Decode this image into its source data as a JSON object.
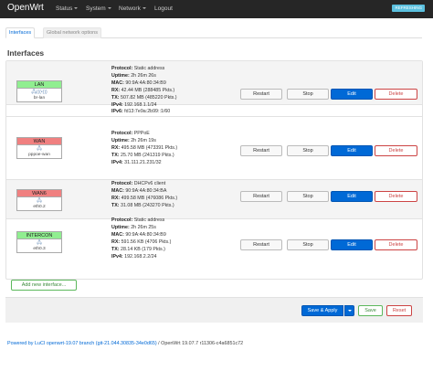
{
  "brand": "OpenWrt",
  "nav": {
    "status": "Status",
    "system": "System",
    "network": "Network",
    "logout": "Logout"
  },
  "badge": "REFRESHING",
  "tabs": [
    "Interfaces",
    "Global network options"
  ],
  "section_title": "Interfaces",
  "interfaces": [
    {
      "name": "LAN",
      "color": "#90ee90",
      "icons": "🖧(((•)))",
      "device": "br-lan",
      "info": [
        {
          "label": "Protocol:",
          "value": "Static address"
        },
        {
          "label": "Uptime:",
          "value": "2h 26m 26s"
        },
        {
          "label": "MAC:",
          "value": "90:9A:4A:80:34:B9"
        },
        {
          "label": "RX:",
          "value": "42.44 MB (288485 Pkts.)"
        },
        {
          "label": "TX:",
          "value": "507.82 MB (485220 Pkts.)"
        },
        {
          "label": "IPv4:",
          "value": "192.168.1.1/24"
        },
        {
          "label": "IPv6:",
          "value": "fd13:7e9a:2b99::1/60"
        }
      ]
    },
    {
      "name": "WAN",
      "color": "#f08080",
      "icons": "🖧",
      "device": "pppoe-wan",
      "info": [
        {
          "label": "Protocol:",
          "value": "PPPoE"
        },
        {
          "label": "Uptime:",
          "value": "2h 26m 19s"
        },
        {
          "label": "RX:",
          "value": "495.58 MB (473391 Pkts.)"
        },
        {
          "label": "TX:",
          "value": "25.70 MB (241319 Pkts.)"
        },
        {
          "label": "IPv4:",
          "value": "31.111.21.231/32"
        }
      ]
    },
    {
      "name": "WAN6",
      "color": "#f08080",
      "icons": "🖧",
      "device": "eth0.2",
      "info": [
        {
          "label": "Protocol:",
          "value": "DHCPv6 client"
        },
        {
          "label": "MAC:",
          "value": "90:9A:4A:80:34:BA"
        },
        {
          "label": "RX:",
          "value": "499.58 MB (476086 Pkts.)"
        },
        {
          "label": "TX:",
          "value": "31.08 MB (243270 Pkts.)"
        }
      ]
    },
    {
      "name": "INTERCON",
      "color": "#90ee90",
      "icons": "🖧",
      "device": "eth0.3",
      "info": [
        {
          "label": "Protocol:",
          "value": "Static address"
        },
        {
          "label": "Uptime:",
          "value": "2h 26m 25s"
        },
        {
          "label": "MAC:",
          "value": "90:9A:4A:80:34:B9"
        },
        {
          "label": "RX:",
          "value": "591.56 KB (4706 Pkts.)"
        },
        {
          "label": "TX:",
          "value": "28.14 KB (179 Pkts.)"
        },
        {
          "label": "IPv4:",
          "value": "192.168.2.2/24"
        }
      ]
    }
  ],
  "buttons": {
    "restart": "Restart",
    "stop": "Stop",
    "edit": "Edit",
    "delete": "Delete",
    "add": "Add new interface...",
    "save_apply": "Save & Apply",
    "save": "Save",
    "reset": "Reset"
  },
  "footer": {
    "link": "Powered by LuCI openwrt-19.07 branch (git-21.044.30835-34e0d65)",
    "separator": " / ",
    "version": "OpenWrt 19.07.7 r11306-c4a6851c72"
  }
}
